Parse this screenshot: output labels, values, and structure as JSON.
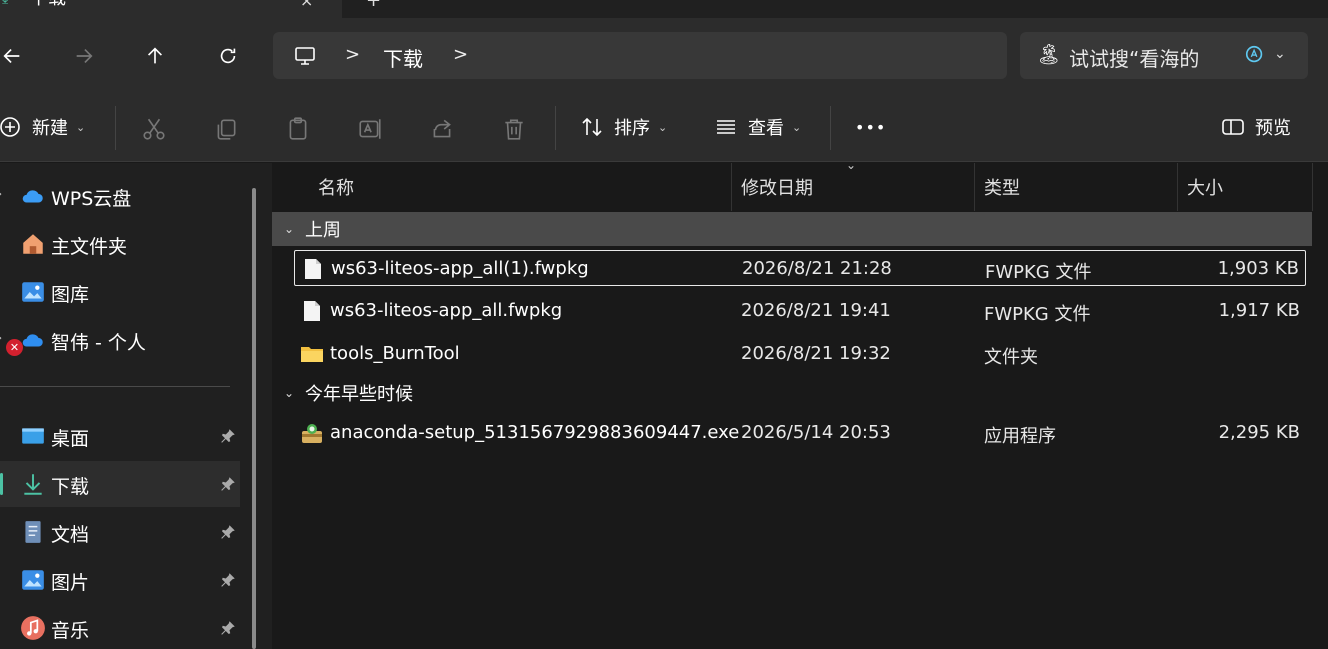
{
  "tab": {
    "label": "下载",
    "close": "×",
    "add": "+"
  },
  "address": {
    "crumb": "下载",
    "sep": ">"
  },
  "search": {
    "placeholder": "试试搜“看海的"
  },
  "toolbar": {
    "new_label": "新建",
    "sort_label": "排序",
    "view_label": "查看",
    "more_label": "•••",
    "preview_label": "预览",
    "dropdown": "⌄"
  },
  "sidebar": {
    "items": [
      {
        "label": "WPS云盘"
      },
      {
        "label": "主文件夹"
      },
      {
        "label": "图库"
      },
      {
        "label": "智伟 - 个人"
      },
      {
        "label": "桌面"
      },
      {
        "label": "下载"
      },
      {
        "label": "文档"
      },
      {
        "label": "图片"
      },
      {
        "label": "音乐"
      }
    ]
  },
  "columns": {
    "name": "名称",
    "date": "修改日期",
    "type": "类型",
    "size": "大小"
  },
  "groups": [
    {
      "label": "上周",
      "files": [
        {
          "name": "ws63-liteos-app_all(1).fwpkg",
          "date": "2026/8/21 21:28",
          "type": "FWPKG 文件",
          "size": "1,903 KB",
          "icon": "file-icon"
        },
        {
          "name": "ws63-liteos-app_all.fwpkg",
          "date": "2026/8/21 19:41",
          "type": "FWPKG 文件",
          "size": "1,917 KB",
          "icon": "file-icon"
        },
        {
          "name": "tools_BurnTool",
          "date": "2026/8/21 19:32",
          "type": "文件夹",
          "size": "",
          "icon": "folder-icon"
        }
      ]
    },
    {
      "label": "今年早些时候",
      "files": [
        {
          "name": "anaconda-setup_5131567929883609447.exe",
          "date": "2026/5/14 20:53",
          "type": "应用程序",
          "size": "2,295 KB",
          "icon": "installer-icon"
        }
      ]
    }
  ],
  "colors": {
    "accent": "#4cc2a4",
    "background": "#191919",
    "panel": "#2c2c2c"
  }
}
